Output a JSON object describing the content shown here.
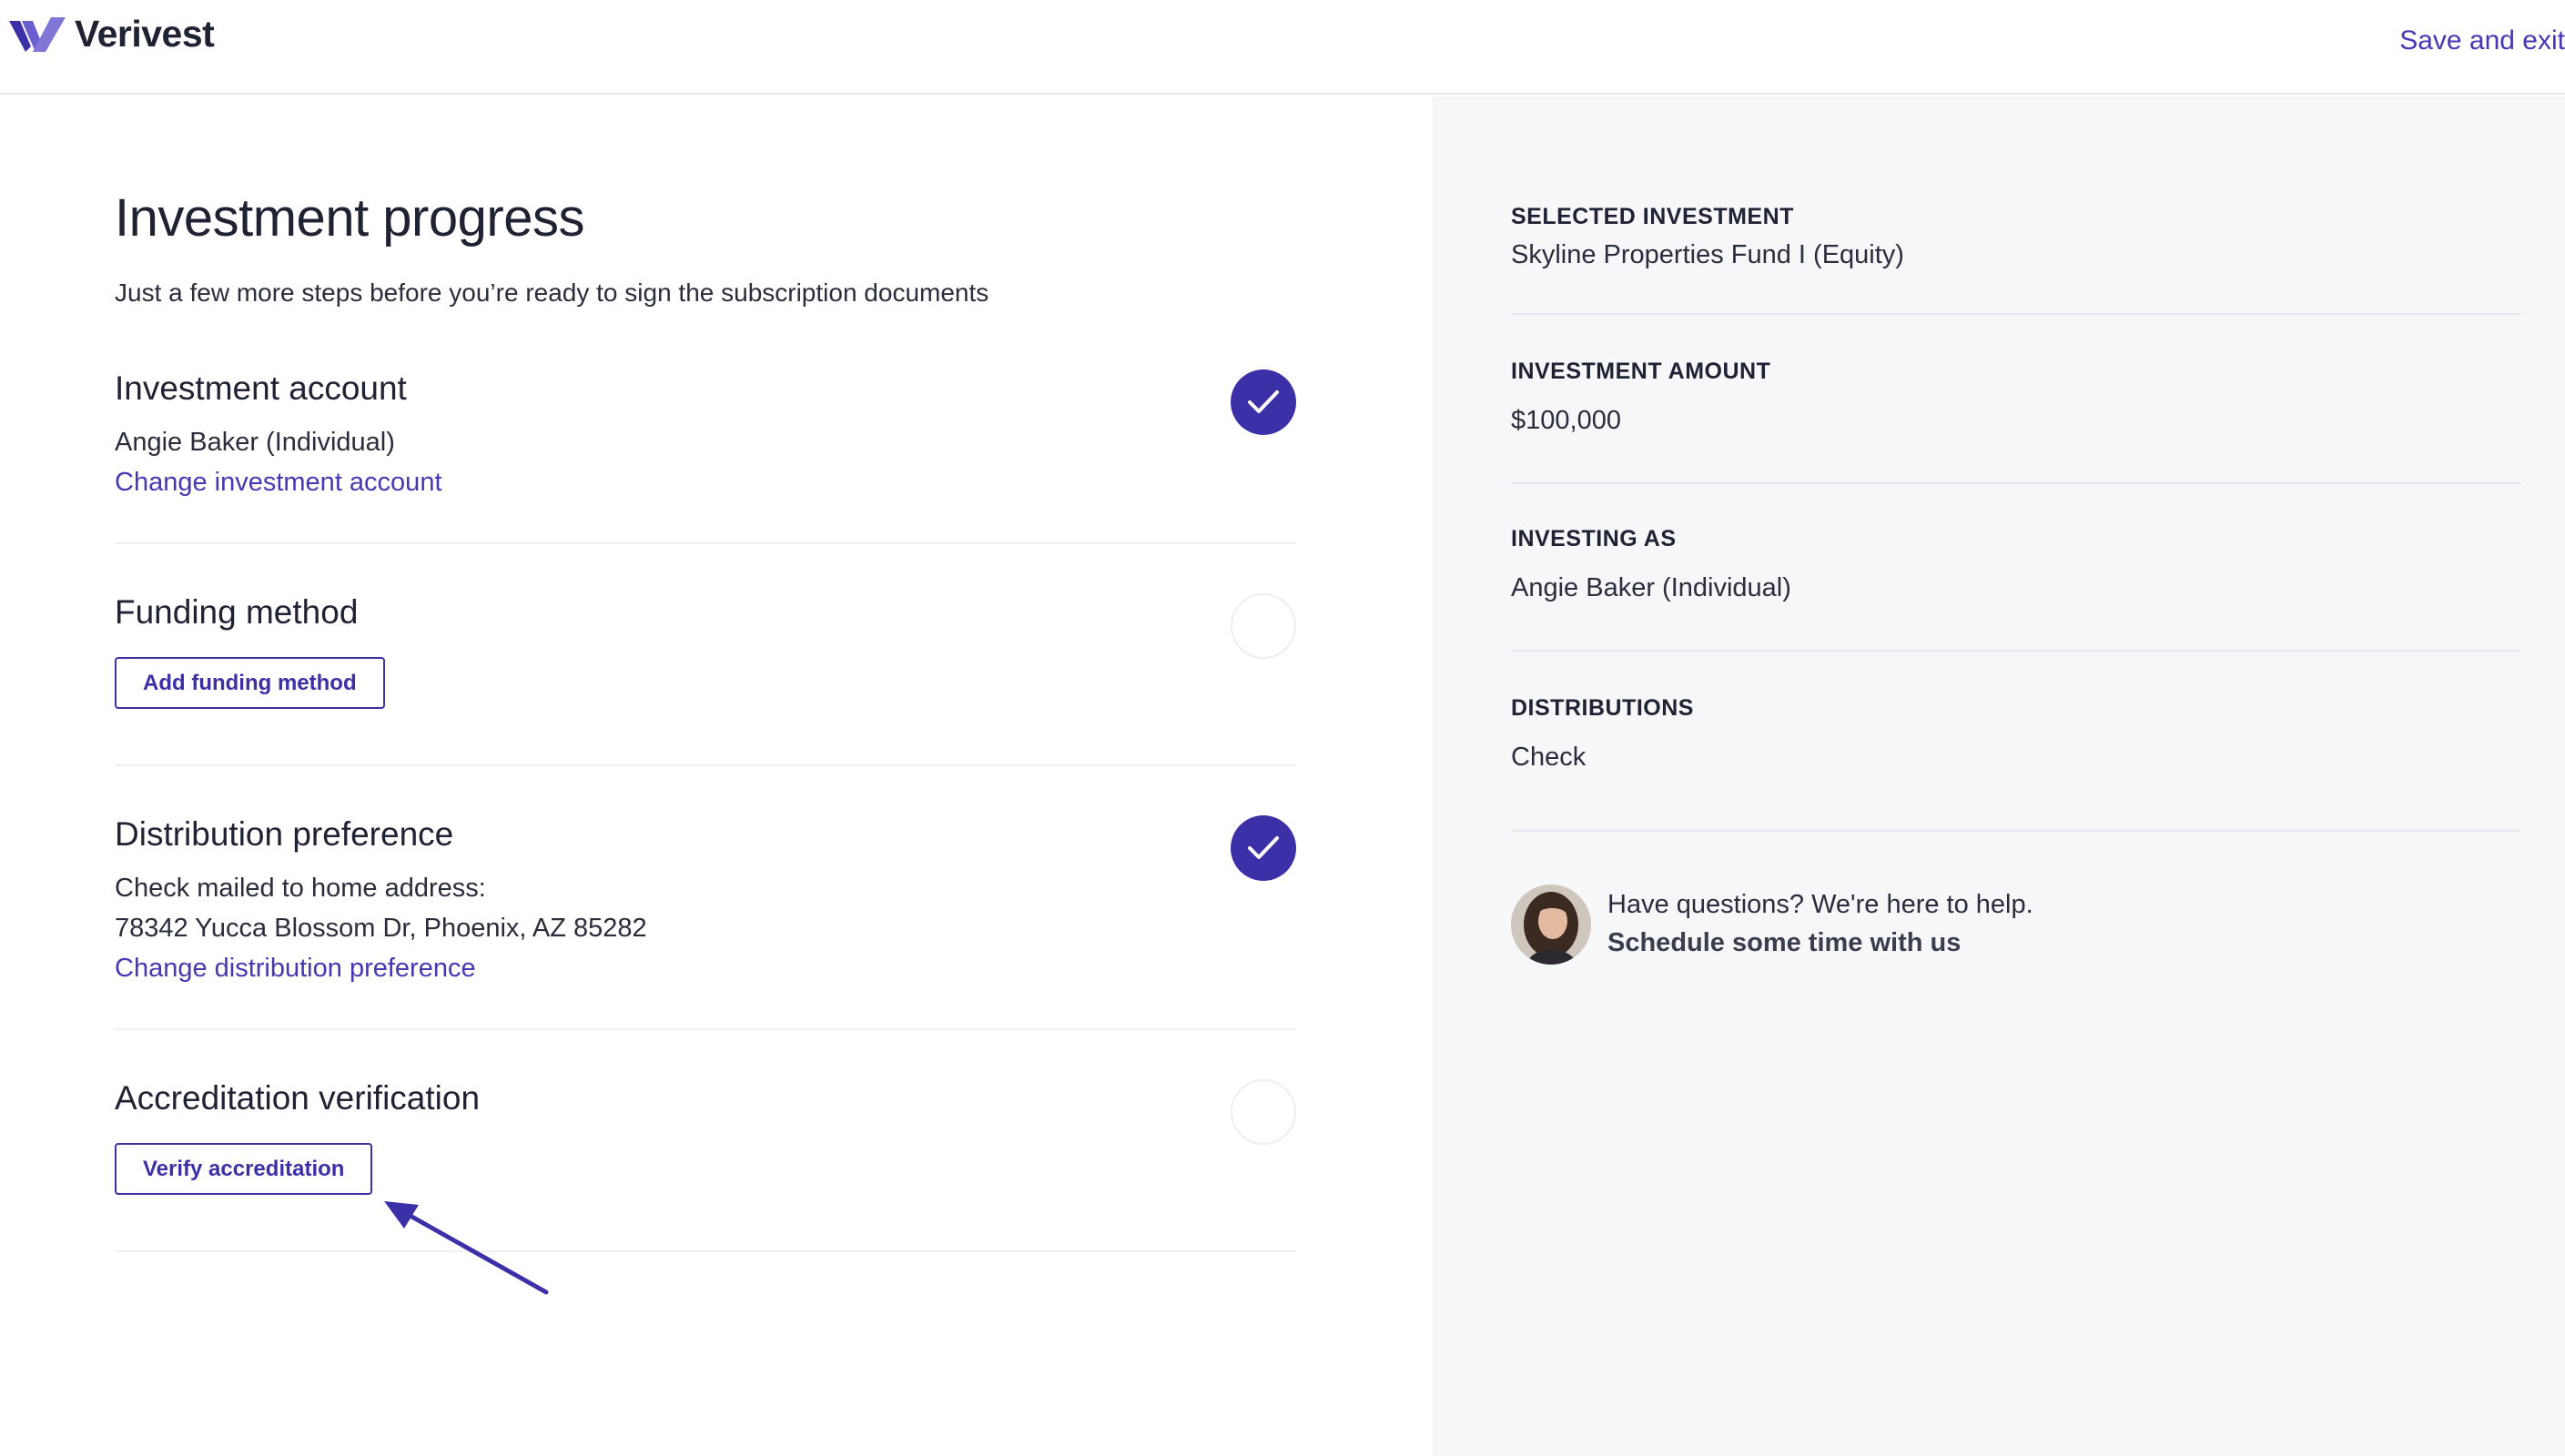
{
  "header": {
    "brand": "Verivest",
    "save_exit": "Save and exit"
  },
  "progress": {
    "title": "Investment progress",
    "subtitle": "Just a few more steps before you’re ready to sign the subscription documents",
    "sections": {
      "account": {
        "title": "Investment account",
        "value": "Angie Baker (Individual)",
        "link": "Change investment account",
        "status": "complete"
      },
      "funding": {
        "title": "Funding method",
        "button": "Add funding method",
        "status": "incomplete"
      },
      "distribution": {
        "title": "Distribution preference",
        "line1": "Check mailed to home address:",
        "line2": "78342 Yucca Blossom Dr, Phoenix, AZ 85282",
        "link": "Change distribution preference",
        "status": "complete"
      },
      "accreditation": {
        "title": "Accreditation verification",
        "button": "Verify accreditation",
        "status": "incomplete"
      }
    }
  },
  "summary": {
    "selected_investment": {
      "label": "SELECTED INVESTMENT",
      "value": "Skyline Properties Fund I (Equity)"
    },
    "investment_amount": {
      "label": "INVESTMENT AMOUNT",
      "value": "$100,000"
    },
    "investing_as": {
      "label": "INVESTING AS",
      "value": "Angie Baker (Individual)"
    },
    "distributions": {
      "label": "DISTRIBUTIONS",
      "value": "Check"
    }
  },
  "help": {
    "text": "Have questions? We're here to help.",
    "link": "Schedule some time with us"
  },
  "icons": {
    "logo": "verivest-logo-icon",
    "complete": "checkmark-icon",
    "incomplete": "empty-circle-icon",
    "annotation": "arrow-icon",
    "avatar": "advisor-avatar"
  },
  "colors": {
    "brand": "#3c30a8",
    "link": "#4637b4",
    "sidebar_bg": "#f6f7f9",
    "text": "#1f2233"
  }
}
